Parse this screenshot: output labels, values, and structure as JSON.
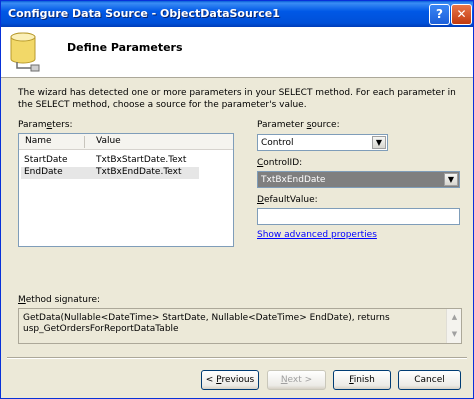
{
  "window": {
    "title": "Configure Data Source - ObjectDataSource1",
    "help_glyph": "?",
    "close_glyph": "✕"
  },
  "header": {
    "heading": "Define Parameters"
  },
  "description": "The wizard has detected one or more parameters in your SELECT method. For each parameter in the SELECT method, choose a source for the parameter's value.",
  "parameters": {
    "label_prefix": "Param",
    "label_accel": "e",
    "label_suffix": "ters:",
    "columns": [
      "Name",
      "Value"
    ],
    "rows": [
      {
        "name": "StartDate",
        "value": "TxtBxStartDate.Text"
      },
      {
        "name": "EndDate",
        "value": "TxtBxEndDate.Text"
      }
    ],
    "selected_row": 1
  },
  "parameter_source": {
    "label_prefix": "Parameter ",
    "label_accel": "s",
    "label_suffix": "ource:",
    "value": "Control"
  },
  "control_id": {
    "label_prefix": "",
    "label_accel": "C",
    "label_suffix": "ontrolID:",
    "value": "TxtBxEndDate"
  },
  "default_value": {
    "label_prefix": "",
    "label_accel": "D",
    "label_suffix": "efaultValue:",
    "value": ""
  },
  "advanced_link": "Show advanced properties",
  "method_signature": {
    "label_prefix": "",
    "label_accel": "M",
    "label_suffix": "ethod signature:",
    "text": "GetData(Nullable<DateTime> StartDate, Nullable<DateTime> EndDate), returns usp_GetOrdersForReportDataTable"
  },
  "buttons": {
    "previous": {
      "prefix": "< ",
      "accel": "P",
      "suffix": "revious"
    },
    "next": {
      "prefix": "",
      "accel": "N",
      "suffix": "ext >"
    },
    "finish": {
      "prefix": "",
      "accel": "F",
      "suffix": "inish"
    },
    "cancel": {
      "label": "Cancel"
    }
  },
  "icons": {
    "dropdown_arrow": "chevron-down-icon",
    "database": "database-icon",
    "scroll_up": "scroll-up-icon",
    "scroll_down": "scroll-down-icon"
  }
}
